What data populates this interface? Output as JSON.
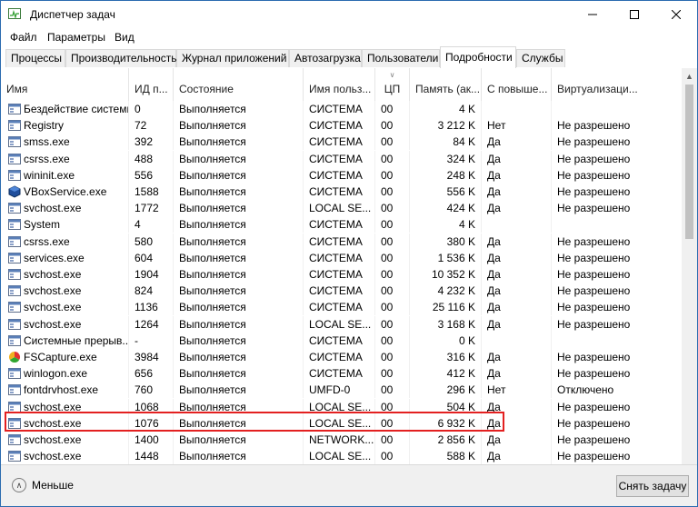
{
  "window": {
    "title": "Диспетчер задач"
  },
  "menu": [
    "Файл",
    "Параметры",
    "Вид"
  ],
  "tabs": [
    "Процессы",
    "Производительность",
    "Журнал приложений",
    "Автозагрузка",
    "Пользователи",
    "Подробности",
    "Службы"
  ],
  "active_tab": "Подробности",
  "columns": [
    "Имя",
    "ИД п...",
    "Состояние",
    "Имя польз...",
    "ЦП",
    "Память (ак...",
    "С повыше...",
    "Виртуализаци..."
  ],
  "rows": [
    {
      "icon": "system-process-icon",
      "name": "Бездействие системы",
      "pid": "0",
      "status": "Выполняется",
      "user": "СИСТЕМА",
      "cpu": "00",
      "mem": "4 K",
      "elevated": "",
      "virt": ""
    },
    {
      "icon": "system-process-icon",
      "name": "Registry",
      "pid": "72",
      "status": "Выполняется",
      "user": "СИСТЕМА",
      "cpu": "00",
      "mem": "3 212 K",
      "elevated": "Нет",
      "virt": "Не разрешено"
    },
    {
      "icon": "system-process-icon",
      "name": "smss.exe",
      "pid": "392",
      "status": "Выполняется",
      "user": "СИСТЕМА",
      "cpu": "00",
      "mem": "84 K",
      "elevated": "Да",
      "virt": "Не разрешено"
    },
    {
      "icon": "system-process-icon",
      "name": "csrss.exe",
      "pid": "488",
      "status": "Выполняется",
      "user": "СИСТЕМА",
      "cpu": "00",
      "mem": "324 K",
      "elevated": "Да",
      "virt": "Не разрешено"
    },
    {
      "icon": "system-process-icon",
      "name": "wininit.exe",
      "pid": "556",
      "status": "Выполняется",
      "user": "СИСТЕМА",
      "cpu": "00",
      "mem": "248 K",
      "elevated": "Да",
      "virt": "Не разрешено"
    },
    {
      "icon": "vbox-icon",
      "name": "VBoxService.exe",
      "pid": "1588",
      "status": "Выполняется",
      "user": "СИСТЕМА",
      "cpu": "00",
      "mem": "556 K",
      "elevated": "Да",
      "virt": "Не разрешено"
    },
    {
      "icon": "system-process-icon",
      "name": "svchost.exe",
      "pid": "1772",
      "status": "Выполняется",
      "user": "LOCAL SE...",
      "cpu": "00",
      "mem": "424 K",
      "elevated": "Да",
      "virt": "Не разрешено"
    },
    {
      "icon": "system-process-icon",
      "name": "System",
      "pid": "4",
      "status": "Выполняется",
      "user": "СИСТЕМА",
      "cpu": "00",
      "mem": "4 K",
      "elevated": "",
      "virt": ""
    },
    {
      "icon": "system-process-icon",
      "name": "csrss.exe",
      "pid": "580",
      "status": "Выполняется",
      "user": "СИСТЕМА",
      "cpu": "00",
      "mem": "380 K",
      "elevated": "Да",
      "virt": "Не разрешено"
    },
    {
      "icon": "system-process-icon",
      "name": "services.exe",
      "pid": "604",
      "status": "Выполняется",
      "user": "СИСТЕМА",
      "cpu": "00",
      "mem": "1 536 K",
      "elevated": "Да",
      "virt": "Не разрешено"
    },
    {
      "icon": "system-process-icon",
      "name": "svchost.exe",
      "pid": "1904",
      "status": "Выполняется",
      "user": "СИСТЕМА",
      "cpu": "00",
      "mem": "10 352 K",
      "elevated": "Да",
      "virt": "Не разрешено"
    },
    {
      "icon": "system-process-icon",
      "name": "svchost.exe",
      "pid": "824",
      "status": "Выполняется",
      "user": "СИСТЕМА",
      "cpu": "00",
      "mem": "4 232 K",
      "elevated": "Да",
      "virt": "Не разрешено"
    },
    {
      "icon": "system-process-icon",
      "name": "svchost.exe",
      "pid": "1136",
      "status": "Выполняется",
      "user": "СИСТЕМА",
      "cpu": "00",
      "mem": "25 116 K",
      "elevated": "Да",
      "virt": "Не разрешено"
    },
    {
      "icon": "system-process-icon",
      "name": "svchost.exe",
      "pid": "1264",
      "status": "Выполняется",
      "user": "LOCAL SE...",
      "cpu": "00",
      "mem": "3 168 K",
      "elevated": "Да",
      "virt": "Не разрешено"
    },
    {
      "icon": "system-process-icon",
      "name": "Системные прерыв...",
      "pid": "-",
      "status": "Выполняется",
      "user": "СИСТЕМА",
      "cpu": "00",
      "mem": "0 K",
      "elevated": "",
      "virt": ""
    },
    {
      "icon": "fscapture-icon",
      "name": "FSCapture.exe",
      "pid": "3984",
      "status": "Выполняется",
      "user": "СИСТЕМА",
      "cpu": "00",
      "mem": "316 K",
      "elevated": "Да",
      "virt": "Не разрешено"
    },
    {
      "icon": "system-process-icon",
      "name": "winlogon.exe",
      "pid": "656",
      "status": "Выполняется",
      "user": "СИСТЕМА",
      "cpu": "00",
      "mem": "412 K",
      "elevated": "Да",
      "virt": "Не разрешено"
    },
    {
      "icon": "system-process-icon",
      "name": "fontdrvhost.exe",
      "pid": "760",
      "status": "Выполняется",
      "user": "UMFD-0",
      "cpu": "00",
      "mem": "296 K",
      "elevated": "Нет",
      "virt": "Отключено"
    },
    {
      "icon": "system-process-icon",
      "name": "svchost.exe",
      "pid": "1068",
      "status": "Выполняется",
      "user": "LOCAL SE...",
      "cpu": "00",
      "mem": "504 K",
      "elevated": "Да",
      "virt": "Не разрешено"
    },
    {
      "icon": "system-process-icon",
      "name": "svchost.exe",
      "pid": "1076",
      "status": "Выполняется",
      "user": "LOCAL SE...",
      "cpu": "00",
      "mem": "6 932 K",
      "elevated": "Да",
      "virt": "Не разрешено"
    },
    {
      "icon": "system-process-icon",
      "name": "svchost.exe",
      "pid": "1400",
      "status": "Выполняется",
      "user": "NETWORK...",
      "cpu": "00",
      "mem": "2 856 K",
      "elevated": "Да",
      "virt": "Не разрешено"
    },
    {
      "icon": "system-process-icon",
      "name": "svchost.exe",
      "pid": "1448",
      "status": "Выполняется",
      "user": "LOCAL SE...",
      "cpu": "00",
      "mem": "588 K",
      "elevated": "Да",
      "virt": "Не разрешено"
    }
  ],
  "highlighted_row": "FSCapture.exe",
  "footer": {
    "fewer_label": "Меньше",
    "end_task_label": "Снять задачу"
  },
  "colors": {
    "highlight": "#e32020",
    "window_border": "#2b6cb0"
  }
}
